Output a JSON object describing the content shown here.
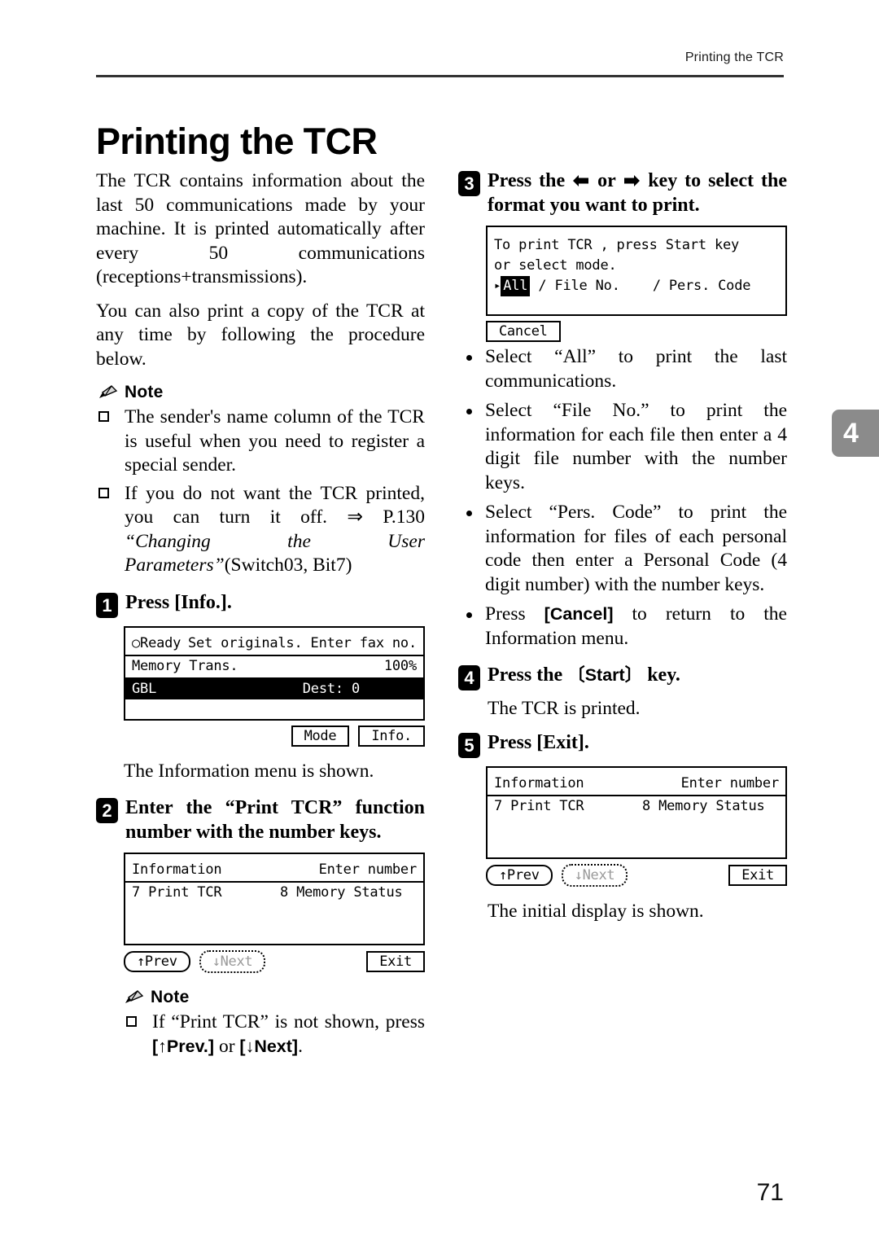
{
  "running_head": "Printing the TCR",
  "page_title": "Printing the TCR",
  "chapter_tab": "4",
  "page_number": "71",
  "note_label": "Note",
  "left": {
    "intro_p1": "The TCR contains information about the last 50 communications made by your machine. It is printed automatically after every 50 communications (receptions+transmissions).",
    "intro_p2": "You can also print a copy of the TCR at any time by following the procedure below.",
    "notes": [
      "The sender's name column of the TCR is useful when you need to register a special sender.",
      "If you do not want the TCR printed, you can turn it off. ⇒ P.130 "
    ],
    "note2_italic": "“Changing the User Parameters”",
    "note2_tail": "(Switch03, Bit7)",
    "step1_num": "1",
    "step1_text": "Press [Info.].",
    "lcd1": {
      "line1_left": "○Ready",
      "line1_right": "Set originals. Enter fax no.",
      "line2_left": "Memory Trans.",
      "line2_right": "100%",
      "line3_left": "GBL",
      "line3_right": "Dest: 0",
      "buttons": [
        "Mode",
        "Info."
      ]
    },
    "after_step1": "The Information menu is shown.",
    "step2_num": "2",
    "step2_text": "Enter the “Print TCR” function number with the number keys.",
    "lcd2": {
      "title": "Information",
      "title_right": "Enter number",
      "item1": "7 Print TCR",
      "item2": "8 Memory Status",
      "btn_prev": "↑Prev",
      "btn_next": "↓Next",
      "btn_exit": "Exit"
    },
    "note_bottom_a": "If “Print TCR” is not shown, press ",
    "note_bottom_key1": "[↑Prev.]",
    "note_bottom_mid": " or ",
    "note_bottom_key2": "[↓Next]",
    "note_bottom_end": "."
  },
  "right": {
    "step3_num": "3",
    "step3_a": "Press the ",
    "step3_b": " or ",
    "step3_c": " key to select the format you want to print.",
    "lcd3": {
      "line1": "To print TCR , press Start key",
      "line2": "or select mode.",
      "line3_marker": "▸",
      "line3_sel": "All",
      "line3_rest": " / File No.    / Pers. Code",
      "cancel": "Cancel"
    },
    "bullets": [
      "Select “All” to print the last communications.",
      "Select “File No.” to print the information for each file then enter a 4 digit file number with the number keys.",
      "Select “Pers. Code” to print the information for files of each personal code then enter a Personal Code (4 digit number) with the number keys."
    ],
    "bullet4_a": "Press ",
    "bullet4_key": "[Cancel]",
    "bullet4_b": " to return to the Information menu.",
    "step4_num": "4",
    "step4_a": "Press the ",
    "step4_key": "〔Start〕",
    "step4_b": " key.",
    "after_step4": "The TCR is printed.",
    "step5_num": "5",
    "step5_text": "Press [Exit].",
    "lcd5": {
      "title": "Information",
      "title_right": "Enter number",
      "item1": "7 Print TCR",
      "item2": "8 Memory Status",
      "btn_prev": "↑Prev",
      "btn_next": "↓Next",
      "btn_exit": "Exit"
    },
    "after_step5": "The initial display is shown."
  }
}
